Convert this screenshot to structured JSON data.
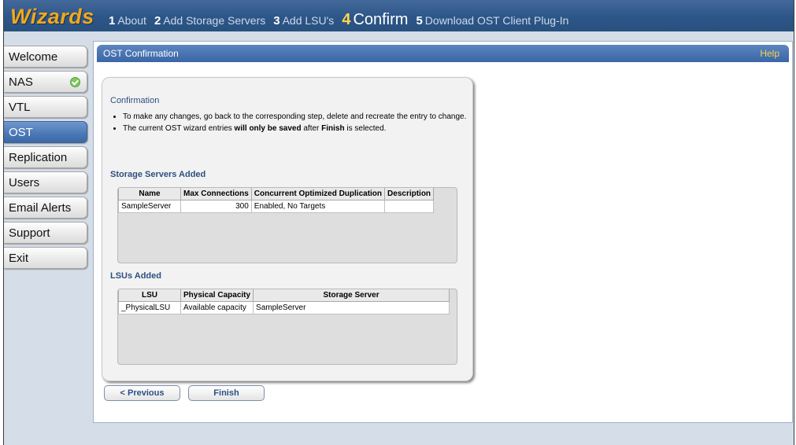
{
  "header": {
    "brand": "Wizards",
    "steps": [
      {
        "num": "1",
        "label": "About"
      },
      {
        "num": "2",
        "label": "Add Storage Servers"
      },
      {
        "num": "3",
        "label": "Add LSU's"
      },
      {
        "num": "4",
        "label": "Confirm"
      },
      {
        "num": "5",
        "label": "Download OST Client Plug-In"
      }
    ]
  },
  "sidebar": {
    "items": [
      {
        "label": "Welcome"
      },
      {
        "label": "NAS"
      },
      {
        "label": "VTL"
      },
      {
        "label": "OST"
      },
      {
        "label": "Replication"
      },
      {
        "label": "Users"
      },
      {
        "label": "Email Alerts"
      },
      {
        "label": "Support"
      },
      {
        "label": "Exit"
      }
    ]
  },
  "panel": {
    "title": "OST Confirmation",
    "help": "Help",
    "confirmation_heading": "Confirmation",
    "bullet1": "To make any changes, go back to the corresponding step, delete and recreate the entry to change.",
    "bullet2_pre": "The current OST wizard entries ",
    "bullet2_bold1": "will only be saved",
    "bullet2_mid": " after ",
    "bullet2_bold2": "Finish",
    "bullet2_post": " is selected."
  },
  "storage_servers": {
    "heading": "Storage Servers Added",
    "columns": [
      "Name",
      "Max Connections",
      "Concurrent Optimized Duplication",
      "Description"
    ],
    "rows": [
      [
        "SampleServer",
        "300",
        "Enabled, No Targets",
        ""
      ]
    ]
  },
  "lsus": {
    "heading": "LSUs Added",
    "columns": [
      "LSU",
      "Physical Capacity",
      "Storage Server"
    ],
    "rows": [
      [
        "_PhysicalLSU",
        "Available capacity",
        "SampleServer"
      ]
    ]
  },
  "buttons": {
    "previous": "< Previous",
    "finish": "Finish"
  }
}
